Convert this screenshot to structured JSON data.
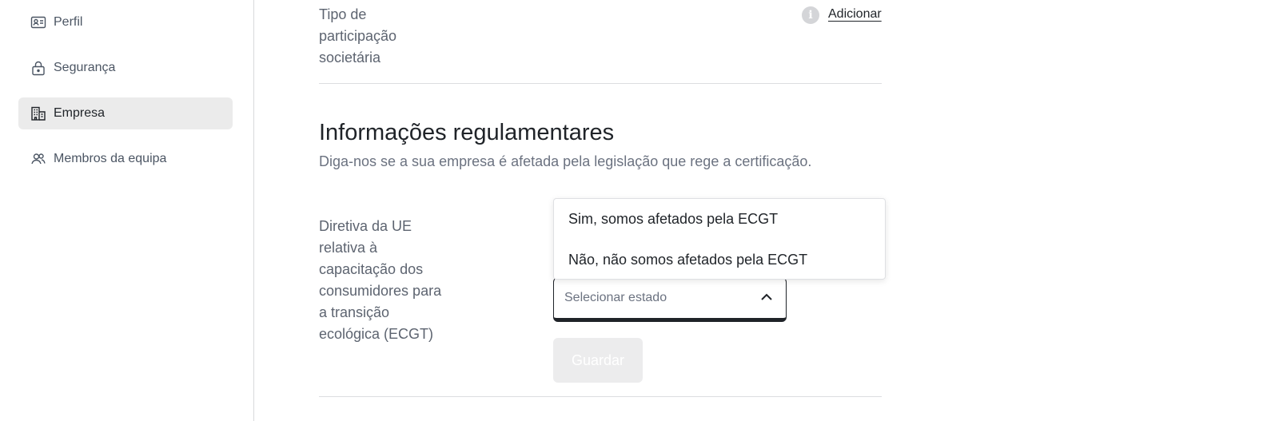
{
  "sidebar": {
    "items": [
      {
        "label": "Perfil",
        "icon": "id-card-icon",
        "active": false
      },
      {
        "label": "Segurança",
        "icon": "lock-icon",
        "active": false
      },
      {
        "label": "Empresa",
        "icon": "building-icon",
        "active": true
      },
      {
        "label": "Membros da equipa",
        "icon": "users-icon",
        "active": false
      }
    ]
  },
  "main": {
    "participation": {
      "label": "Tipo de participação societária",
      "add_label": "Adicionar",
      "info_icon": "info-icon"
    },
    "regulatory": {
      "title": "Informações regulamentares",
      "subtitle": "Diga-nos se a sua empresa é afetada pela legislação que rege a certificação.",
      "ecgt_label": "Diretiva da UE relativa à capacitação dos consumidores para a transição ecológica (ECGT)",
      "select_placeholder": "Selecionar estado",
      "options": [
        "Sim, somos afetados pela ECGT",
        "Não, não somos afetados pela ECGT"
      ],
      "save_label": "Guardar"
    }
  },
  "colors": {
    "active_nav_bg": "#ebebeb",
    "disabled_button_bg": "#ececed",
    "text_primary": "#1f2328",
    "text_muted": "#6b7280"
  }
}
